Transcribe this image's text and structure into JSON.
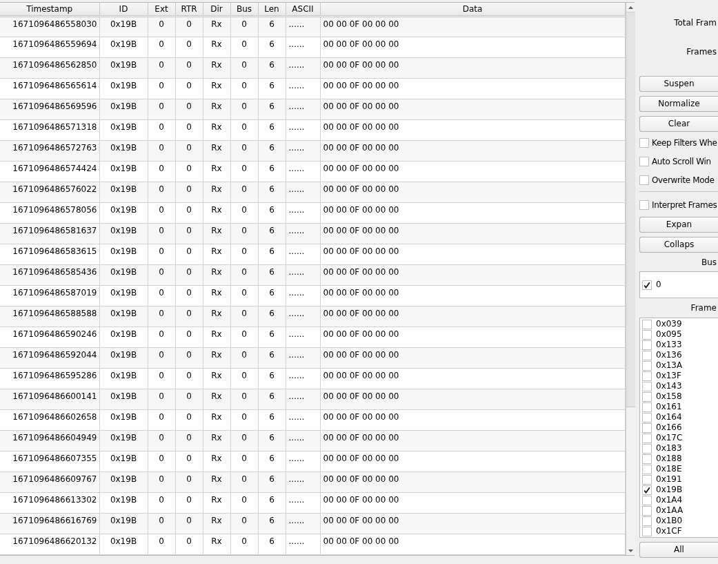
{
  "table": {
    "columns": [
      "Timestamp",
      "ID",
      "Ext",
      "RTR",
      "Dir",
      "Bus",
      "Len",
      "ASCII",
      "Data"
    ],
    "rows": [
      [
        "1671096486558030",
        "0x19B",
        "0",
        "0",
        "Rx",
        "0",
        "6",
        "......",
        "00 00 0F 00 00 00"
      ],
      [
        "1671096486559694",
        "0x19B",
        "0",
        "0",
        "Rx",
        "0",
        "6",
        "......",
        "00 00 0F 00 00 00"
      ],
      [
        "1671096486562850",
        "0x19B",
        "0",
        "0",
        "Rx",
        "0",
        "6",
        "......",
        "00 00 0F 00 00 00"
      ],
      [
        "1671096486565614",
        "0x19B",
        "0",
        "0",
        "Rx",
        "0",
        "6",
        "......",
        "00 00 0F 00 00 00"
      ],
      [
        "1671096486569596",
        "0x19B",
        "0",
        "0",
        "Rx",
        "0",
        "6",
        "......",
        "00 00 0F 00 00 00"
      ],
      [
        "1671096486571318",
        "0x19B",
        "0",
        "0",
        "Rx",
        "0",
        "6",
        "......",
        "00 00 0F 00 00 00"
      ],
      [
        "1671096486572763",
        "0x19B",
        "0",
        "0",
        "Rx",
        "0",
        "6",
        "......",
        "00 00 0F 00 00 00"
      ],
      [
        "1671096486574424",
        "0x19B",
        "0",
        "0",
        "Rx",
        "0",
        "6",
        "......",
        "00 00 0F 00 00 00"
      ],
      [
        "1671096486576022",
        "0x19B",
        "0",
        "0",
        "Rx",
        "0",
        "6",
        "......",
        "00 00 0F 00 00 00"
      ],
      [
        "1671096486578056",
        "0x19B",
        "0",
        "0",
        "Rx",
        "0",
        "6",
        "......",
        "00 00 0F 00 00 00"
      ],
      [
        "1671096486581637",
        "0x19B",
        "0",
        "0",
        "Rx",
        "0",
        "6",
        "......",
        "00 00 0F 00 00 00"
      ],
      [
        "1671096486583615",
        "0x19B",
        "0",
        "0",
        "Rx",
        "0",
        "6",
        "......",
        "00 00 0F 00 00 00"
      ],
      [
        "1671096486585436",
        "0x19B",
        "0",
        "0",
        "Rx",
        "0",
        "6",
        "......",
        "00 00 0F 00 00 00"
      ],
      [
        "1671096486587019",
        "0x19B",
        "0",
        "0",
        "Rx",
        "0",
        "6",
        "......",
        "00 00 0F 00 00 00"
      ],
      [
        "1671096486588588",
        "0x19B",
        "0",
        "0",
        "Rx",
        "0",
        "6",
        "......",
        "00 00 0F 00 00 00"
      ],
      [
        "1671096486590246",
        "0x19B",
        "0",
        "0",
        "Rx",
        "0",
        "6",
        "......",
        "00 00 0F 00 00 00"
      ],
      [
        "1671096486592044",
        "0x19B",
        "0",
        "0",
        "Rx",
        "0",
        "6",
        "......",
        "00 00 0F 00 00 00"
      ],
      [
        "1671096486595286",
        "0x19B",
        "0",
        "0",
        "Rx",
        "0",
        "6",
        "......",
        "00 00 0F 00 00 00"
      ],
      [
        "1671096486600141",
        "0x19B",
        "0",
        "0",
        "Rx",
        "0",
        "6",
        "......",
        "00 00 0F 00 00 00"
      ],
      [
        "1671096486602658",
        "0x19B",
        "0",
        "0",
        "Rx",
        "0",
        "6",
        "......",
        "00 00 0F 00 00 00"
      ],
      [
        "1671096486604949",
        "0x19B",
        "0",
        "0",
        "Rx",
        "0",
        "6",
        "......",
        "00 00 0F 00 00 00"
      ],
      [
        "1671096486607355",
        "0x19B",
        "0",
        "0",
        "Rx",
        "0",
        "6",
        "......",
        "00 00 0F 00 00 00"
      ],
      [
        "1671096486609767",
        "0x19B",
        "0",
        "0",
        "Rx",
        "0",
        "6",
        "......",
        "00 00 0F 00 00 00"
      ],
      [
        "1671096486613302",
        "0x19B",
        "0",
        "0",
        "Rx",
        "0",
        "6",
        "......",
        "00 00 0F 00 00 00"
      ],
      [
        "1671096486616769",
        "0x19B",
        "0",
        "0",
        "Rx",
        "0",
        "6",
        "......",
        "00 00 0F 00 00 00"
      ],
      [
        "1671096486620132",
        "0x19B",
        "0",
        "0",
        "Rx",
        "0",
        "6",
        "......",
        "00 00 0F 00 00 00"
      ]
    ]
  },
  "side_panel": {
    "items": [
      {
        "kind": "label",
        "text": "Total Fram"
      },
      {
        "kind": "label",
        "text": "Frames"
      },
      {
        "kind": "button",
        "text": "Suspen"
      },
      {
        "kind": "button",
        "text": "Normalize"
      },
      {
        "kind": "button",
        "text": "Clear"
      },
      {
        "kind": "checkbox",
        "text": "Keep Filters Whe",
        "checked": false
      },
      {
        "kind": "checkbox",
        "text": "Auto Scroll Win",
        "checked": false
      },
      {
        "kind": "checkbox",
        "text": "Overwrite Mode",
        "checked": false
      },
      {
        "kind": "separator"
      },
      {
        "kind": "checkbox",
        "text": "Interpret Frames",
        "checked": false
      },
      {
        "kind": "button",
        "text": "Expan"
      },
      {
        "kind": "button",
        "text": "Collaps"
      },
      {
        "kind": "label",
        "text": "Bus"
      },
      {
        "kind": "checklist",
        "items": [
          {
            "text": "0",
            "checked": true
          }
        ]
      },
      {
        "kind": "label",
        "text": "Frame"
      },
      {
        "kind": "checklist",
        "items": [
          {
            "text": "0x039",
            "checked": false
          },
          {
            "text": "0x095",
            "checked": false
          },
          {
            "text": "0x133",
            "checked": false
          },
          {
            "text": "0x136",
            "checked": false
          },
          {
            "text": "0x13A",
            "checked": false
          },
          {
            "text": "0x13F",
            "checked": false
          },
          {
            "text": "0x143",
            "checked": false
          },
          {
            "text": "0x158",
            "checked": false
          },
          {
            "text": "0x161",
            "checked": false
          },
          {
            "text": "0x164",
            "checked": false
          },
          {
            "text": "0x166",
            "checked": false
          },
          {
            "text": "0x17C",
            "checked": false
          },
          {
            "text": "0x183",
            "checked": false
          },
          {
            "text": "0x188",
            "checked": false
          },
          {
            "text": "0x18E",
            "checked": false
          },
          {
            "text": "0x191",
            "checked": false
          },
          {
            "text": "0x19B",
            "checked": true
          },
          {
            "text": "0x1A4",
            "checked": false
          },
          {
            "text": "0x1AA",
            "checked": false
          },
          {
            "text": "0x1B0",
            "checked": false
          },
          {
            "text": "0x1CF",
            "checked": false
          }
        ]
      },
      {
        "kind": "button",
        "text": "All"
      }
    ]
  }
}
